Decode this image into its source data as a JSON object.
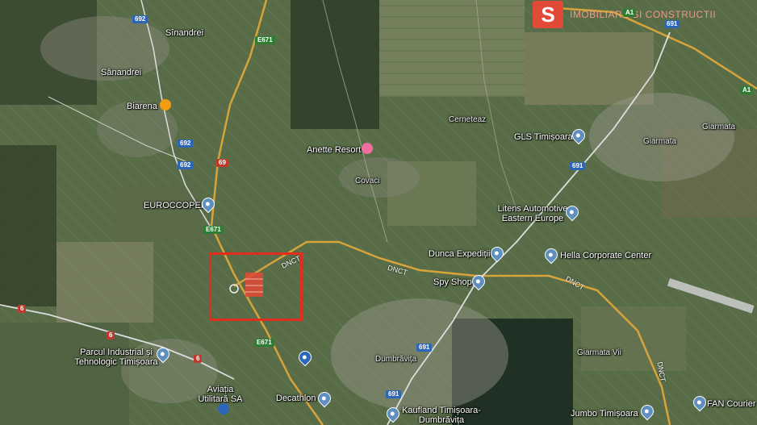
{
  "brand": {
    "mark": "S",
    "text": "IMOBILIARE SI CONSTRUCTII",
    "color": "#e24a38"
  },
  "places": {
    "sinandrei_top": "Sînandrei",
    "sanandrei": "Sânandrei",
    "biarena": "Biarena",
    "anette": "Anette Resort",
    "covaci": "Covaci",
    "cerneteaz": "Cerneteaz",
    "gls": "GLS Timișoara",
    "giarmata1": "Giarmata",
    "giarmata2": "Giarmata",
    "euroccoper": "EUROCCOPER",
    "litens": "Litens Automotive Eastern Europe",
    "dunca": "Dunca Expediții",
    "hella": "Hella Corporate Center",
    "spyshop": "Spy Shop",
    "parcul": "Parcul Industrial și Tehnologic Timișoara",
    "dumbravita": "Dumbrăvița",
    "giarmata_vii": "Giarmata Vii",
    "aviatia": "Aviația Utilitară SA",
    "decathlon": "Decathlon",
    "kaufland": "Kaufland Timișoara-Dumbrăvița",
    "jumbo": "Jumbo Timișoara",
    "fan": "FAN Courier"
  },
  "roads": {
    "r692a": "692",
    "r692b": "692",
    "r692c": "692",
    "e671a": "E671",
    "e671b": "E671",
    "e671c": "E671",
    "r69": "69",
    "a1a": "A1",
    "a1b": "A1",
    "r691a": "691",
    "r691b": "691",
    "r691c": "691",
    "r691d": "691",
    "r6a": "6",
    "r6b": "6",
    "r6c": "6",
    "dnct1": "DNCT",
    "dnct2": "DNCT",
    "dnct3": "DNCT",
    "dnct4": "DNCT"
  },
  "icons": {
    "target_area": "highlight-rectangle",
    "pins": "place-pin-icon",
    "restaurant": "restaurant-icon",
    "hotel": "hotel-icon",
    "shopping": "shopping-bag-icon",
    "airport": "airport-icon"
  },
  "colors": {
    "highlight": "#e32b1e",
    "pin": "#5f8fbf",
    "road_primary": "#d7a33b",
    "road_secondary": "#ddd"
  }
}
